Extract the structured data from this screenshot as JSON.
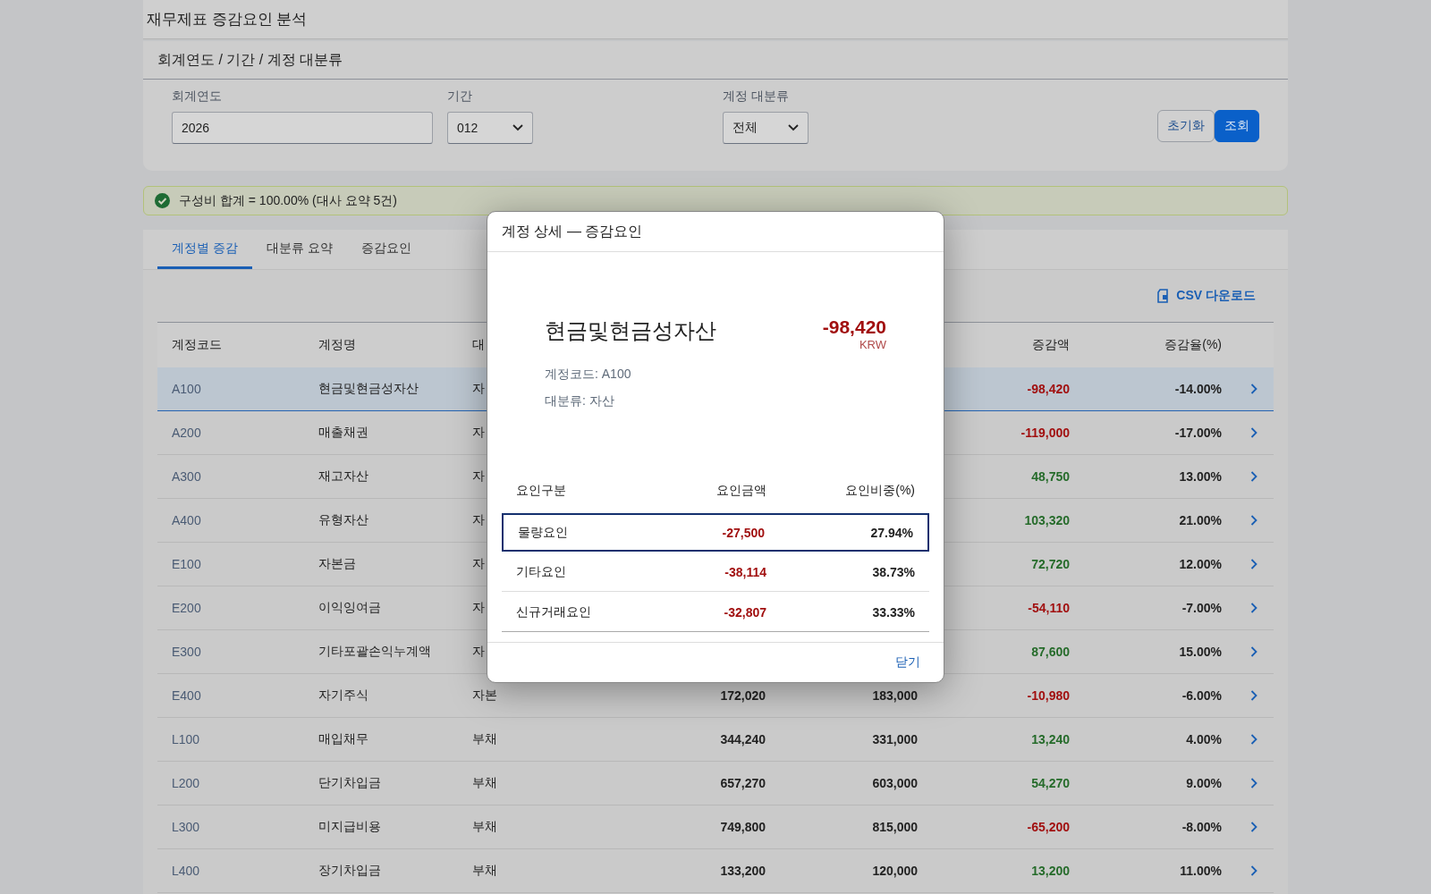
{
  "page_title": "재무제표 증감요인 분석",
  "filter_panel": {
    "title": "회계연도 / 기간 / 계정 대분류",
    "fields": [
      {
        "kind": "input",
        "label": "회계연도",
        "value": "2026"
      },
      {
        "kind": "select",
        "label": "기간",
        "value": "012"
      },
      {
        "kind": "select",
        "label": "계정 대분류",
        "value": "전체"
      }
    ],
    "buttons": [
      {
        "label": "초기화",
        "primary": false
      },
      {
        "label": "조회",
        "primary": true
      }
    ]
  },
  "alert": {
    "text": "구성비 합계 = 100.00% (대사 요약 5건)"
  },
  "tabs": [
    {
      "label": "계정별 증감",
      "selected": true
    },
    {
      "label": "대분류 요약",
      "selected": false
    },
    {
      "label": "증감요인",
      "selected": false
    }
  ],
  "csv_button": "CSV 다운로드",
  "table": {
    "columns": {
      "column_1": "계정코드",
      "column_2": "계정명",
      "column_3": "대",
      "column_6": "증감액",
      "column_7": "증감율(%)"
    },
    "rows": [
      {
        "selected": true,
        "code": "A100",
        "name": "현금및현금성자산",
        "category": "자",
        "change": "-98,420",
        "color": "#a10f0f",
        "rate": "-14.00%"
      },
      {
        "selected": false,
        "code": "A200",
        "name": "매출채권",
        "category": "자",
        "change": "-119,000",
        "color": "#a10f0f",
        "rate": "-17.00%"
      },
      {
        "selected": false,
        "code": "A300",
        "name": "재고자산",
        "category": "자",
        "change": "48,750",
        "color": "#256b2a",
        "rate": "13.00%"
      },
      {
        "selected": false,
        "code": "A400",
        "name": "유형자산",
        "category": "자",
        "change": "103,320",
        "color": "#256b2a",
        "rate": "21.00%"
      },
      {
        "selected": false,
        "code": "E100",
        "name": "자본금",
        "category": "자",
        "change": "72,720",
        "color": "#256b2a",
        "rate": "12.00%"
      },
      {
        "selected": false,
        "code": "E200",
        "name": "이익잉여금",
        "category": "자",
        "change": "-54,110",
        "color": "#a10f0f",
        "rate": "-7.00%"
      },
      {
        "selected": false,
        "code": "E300",
        "name": "기타포괄손익누계액",
        "category": "자",
        "change": "87,600",
        "color": "#256b2a",
        "rate": "15.00%"
      },
      {
        "selected": false,
        "code": "E400",
        "name": "자기주식",
        "category": "자본",
        "column_4": "172,020",
        "column_5": "183,000",
        "change": "-10,980",
        "color": "#a10f0f",
        "rate": "-6.00%"
      },
      {
        "selected": false,
        "code": "L100",
        "name": "매입채무",
        "category": "부채",
        "column_4": "344,240",
        "column_5": "331,000",
        "change": "13,240",
        "color": "#256b2a",
        "rate": "4.00%"
      },
      {
        "selected": false,
        "code": "L200",
        "name": "단기차입금",
        "category": "부채",
        "column_4": "657,270",
        "column_5": "603,000",
        "change": "54,270",
        "color": "#256b2a",
        "rate": "9.00%"
      },
      {
        "selected": false,
        "code": "L300",
        "name": "미지급비용",
        "category": "부채",
        "column_4": "749,800",
        "column_5": "815,000",
        "change": "-65,200",
        "color": "#a10f0f",
        "rate": "-8.00%"
      },
      {
        "selected": false,
        "code": "L400",
        "name": "장기차입금",
        "category": "부채",
        "column_4": "133,200",
        "column_5": "120,000",
        "change": "13,200",
        "color": "#256b2a",
        "rate": "11.00%"
      }
    ]
  },
  "dialog": {
    "title": "계정 상세 — 증감요인",
    "account_name": "현금및현금성자산",
    "amount": "-98,420",
    "currency": "KRW",
    "code_line": "계정코드: A100",
    "category_line": "대분류: 자산",
    "factor_columns": [
      "요인구분",
      "요인금액",
      "요인비중(%)"
    ],
    "factors": [
      {
        "selected": true,
        "name": "물량요인",
        "amount": "-27,500",
        "share": "27.94%"
      },
      {
        "selected": false,
        "name": "기타요인",
        "amount": "-38,114",
        "share": "38.73%"
      },
      {
        "selected": false,
        "name": "신규거래요인",
        "amount": "-32,807",
        "share": "33.33%"
      }
    ],
    "close_button": "닫기"
  }
}
